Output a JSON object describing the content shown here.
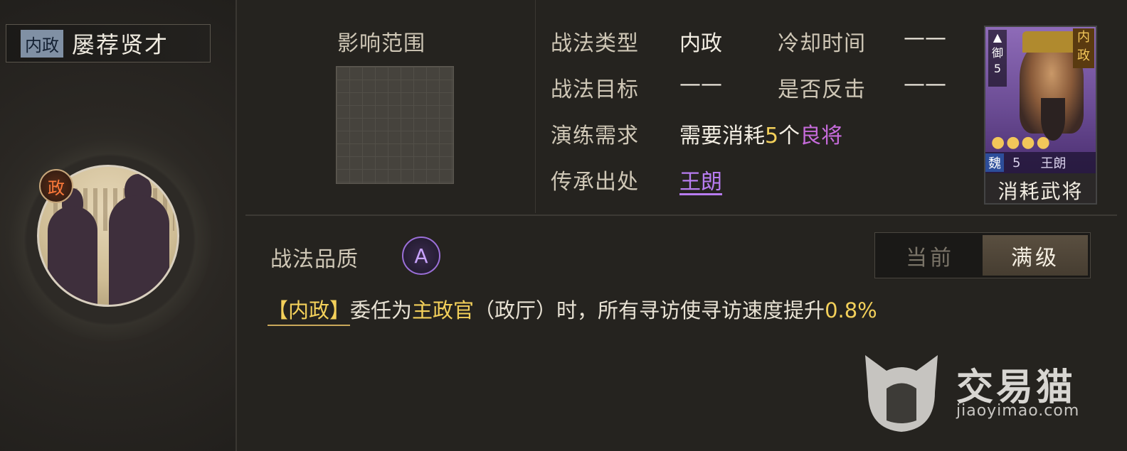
{
  "skill": {
    "type_tag": "内政",
    "name": "屡荐贤才",
    "emblem": "政"
  },
  "range": {
    "title": "影响范围"
  },
  "info": {
    "skill_type_label": "战法类型",
    "skill_type_value": "内政",
    "cooldown_label": "冷却时间",
    "cooldown_value": "——",
    "target_label": "战法目标",
    "target_value": "——",
    "counter_label": "是否反击",
    "counter_value": "——",
    "drill_label": "演练需求",
    "drill_prefix": "需要消耗",
    "drill_count": "5",
    "drill_unit": "个",
    "drill_item": "良将",
    "origin_label": "传承出处",
    "origin_value": "王朗"
  },
  "card": {
    "rank_char": "御",
    "rank_num": "5",
    "type": "内政",
    "stars": "●●●●",
    "kingdom": "魏",
    "level": "5",
    "general_name": "王朗",
    "label": "消耗武将"
  },
  "quality": {
    "label": "战法品质",
    "grade": "A"
  },
  "toggle": {
    "current": "当前",
    "max": "满级",
    "selected": "max"
  },
  "description": {
    "tag": "【内政】",
    "part1": "委任为",
    "highlight1": "主政官",
    "part2": "（政厅）时，所有寻访使寻访速度提升",
    "value": "0.8%"
  },
  "watermark": {
    "brand": "交易猫",
    "url": "jiaoyimao.com"
  },
  "colors": {
    "accent_yellow": "#f3d05a",
    "accent_purple": "#c66bdb",
    "background": "#25231f"
  }
}
